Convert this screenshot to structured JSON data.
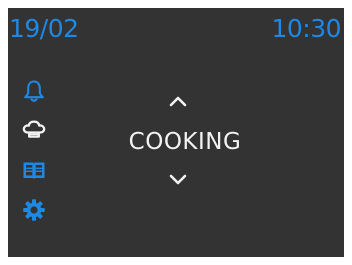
{
  "status": {
    "date": "19/02",
    "time": "10:30"
  },
  "menu": {
    "current_label": "COOKING"
  },
  "sidebar": {
    "items": [
      {
        "icon": "bell-icon"
      },
      {
        "icon": "chef-hat-icon"
      },
      {
        "icon": "book-icon"
      },
      {
        "icon": "gear-icon"
      }
    ]
  },
  "colors": {
    "background": "#333333",
    "accent_blue": "#1e88e5",
    "text_white": "#f2f2f2",
    "frame": "#ffffff"
  }
}
